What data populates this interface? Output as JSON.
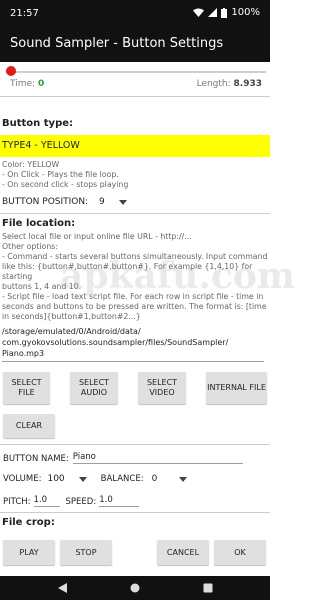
{
  "status": {
    "time": "21:57",
    "battery": "100%"
  },
  "app": {
    "title": "Sound Sampler - Button Settings"
  },
  "player": {
    "time_label": "Time:",
    "time_value": "0",
    "length_label": "Length:",
    "length_value": "8.933",
    "progress": 0
  },
  "button_type": {
    "heading": "Button type:",
    "selected": "TYPE4 - YELLOW",
    "color": "#ffff00",
    "lines": [
      "Color: YELLOW",
      "- On Click - Plays the file loop.",
      "- On second click - stops playing"
    ]
  },
  "position": {
    "label": "BUTTON POSITION:",
    "value": "9"
  },
  "file_location": {
    "heading": "File location:",
    "lines": [
      "Select local file or input online file URL - http://...",
      "Other options:",
      "- Command - starts several buttons simultaneously. Input command",
      "like this: {button#,button#,button#}. For example {1,4,10} for starting",
      "buttons 1, 4 and 10.",
      "- Script file - load text script file. For each row in script file - time in",
      "seconds and buttons to be pressed are written. The format is: [time",
      "in seconds]{button#1,button#2...}"
    ],
    "path_lines": [
      "/storage/emulated/0/Android/data/",
      "com.gyokovsolutions.soundsampler/files/SoundSampler/",
      "Piano.mp3"
    ]
  },
  "buttons": {
    "select_file": "SELECT FILE",
    "select_audio": "SELECT AUDIO",
    "select_video": "SELECT VIDEO",
    "internal_file": "INTERNAL FILE",
    "clear": "CLEAR"
  },
  "button_name": {
    "label": "BUTTON NAME:",
    "value": "Piano"
  },
  "volume": {
    "label": "VOLUME:",
    "value": "100"
  },
  "balance": {
    "label": "BALANCE:",
    "value": "0"
  },
  "pitch": {
    "label": "PITCH:",
    "value": "1.0"
  },
  "speed": {
    "label": "SPEED:",
    "value": "1.0"
  },
  "file_crop": {
    "heading": "File crop:"
  },
  "bottom": {
    "play": "PLAY",
    "stop": "STOP",
    "cancel": "CANCEL",
    "ok": "OK"
  },
  "watermark": "apkafu.com"
}
